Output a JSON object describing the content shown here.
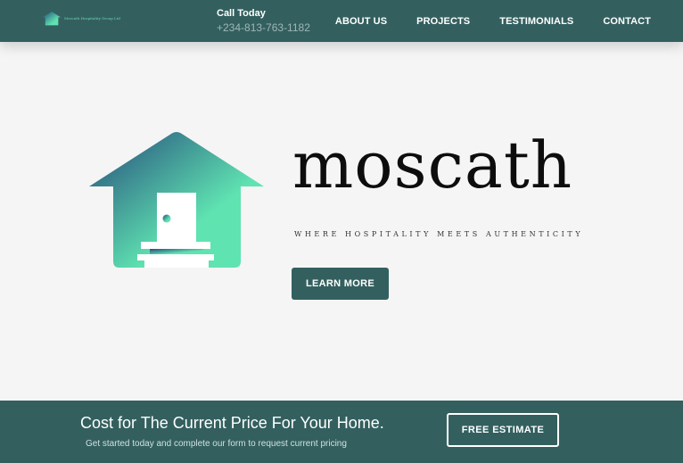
{
  "header": {
    "logo_text": "Moscath Hospitality Group Ltd",
    "call_label": "Call Today",
    "phone": "+234-813-763-1182",
    "nav": [
      {
        "label": "ABOUT US"
      },
      {
        "label": "PROJECTS"
      },
      {
        "label": "TESTIMONIALS"
      },
      {
        "label": "CONTACT"
      }
    ]
  },
  "hero": {
    "brand": "moscath",
    "tagline": "WHERE HOSPITALITY MEETS AUTHENTICITY",
    "cta_label": "LEARN MORE",
    "icon": "house-icon"
  },
  "footer_band": {
    "title": "Cost for The Current Price For Your Home.",
    "subtitle": "Get started today and complete our form to request current pricing",
    "button_label": "FREE ESTIMATE"
  },
  "colors": {
    "primary": "#33605f",
    "gradient_start": "#24497a",
    "gradient_end": "#5fe3b1",
    "background": "#f5f5f5"
  }
}
